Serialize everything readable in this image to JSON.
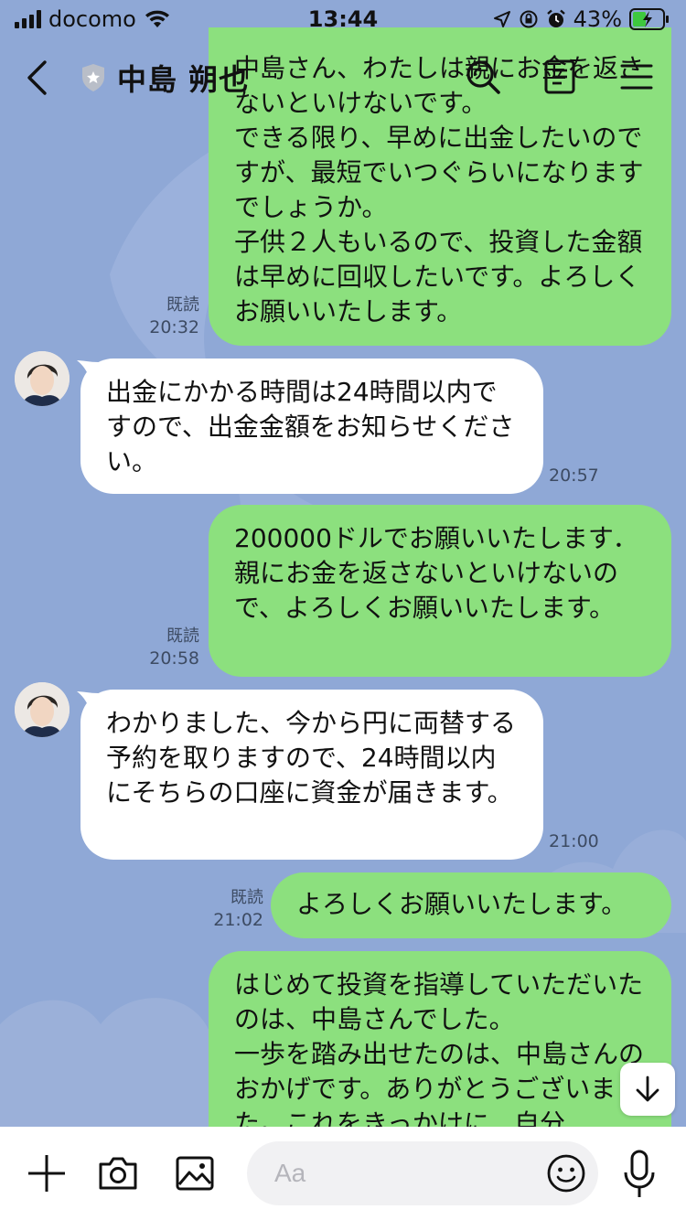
{
  "status_bar": {
    "carrier": "docomo",
    "time": "13:44",
    "battery": "43%"
  },
  "header": {
    "contact_name": "中島 朔也"
  },
  "colors": {
    "background": "#8fa8d6",
    "outgoing_bubble": "#8ce07e",
    "incoming_bubble": "#ffffff"
  },
  "messages": [
    {
      "direction": "out",
      "text": "中島さん、わたしは親にお金を返さないといけないです。\nできる限り、早めに出金したいのですが、最短でいつぐらいになりますでしょうか。\n子供２人もいるので、投資した金額は早めに回収したいです。よろしくお願いいたします。",
      "read": "既読",
      "time": "20:32"
    },
    {
      "direction": "in",
      "text": "出金にかかる時間は24時間以内ですので、出金金額をお知らせください。",
      "time": "20:57"
    },
    {
      "direction": "out",
      "text": "200000ドルでお願いいたします．親にお金を返さないといけないので、よろしくお願いいたします。",
      "read": "既読",
      "time": "20:58"
    },
    {
      "direction": "in",
      "text": "わかりました、今から円に両替する予約を取りますので、24時間以内にそちらの口座に資金が届きます。",
      "time": "21:00"
    },
    {
      "direction": "out",
      "text": "よろしくお願いいたします。",
      "read": "既読",
      "time": "21:02"
    },
    {
      "direction": "out",
      "text": "はじめて投資を指導していただいたのは、中島さんでした。\n一歩を踏み出せたのは、中島さんのおかげです。ありがとうございました。これをきっかけに、自分",
      "read": "",
      "time": ""
    }
  ],
  "input": {
    "placeholder": "Aa"
  }
}
